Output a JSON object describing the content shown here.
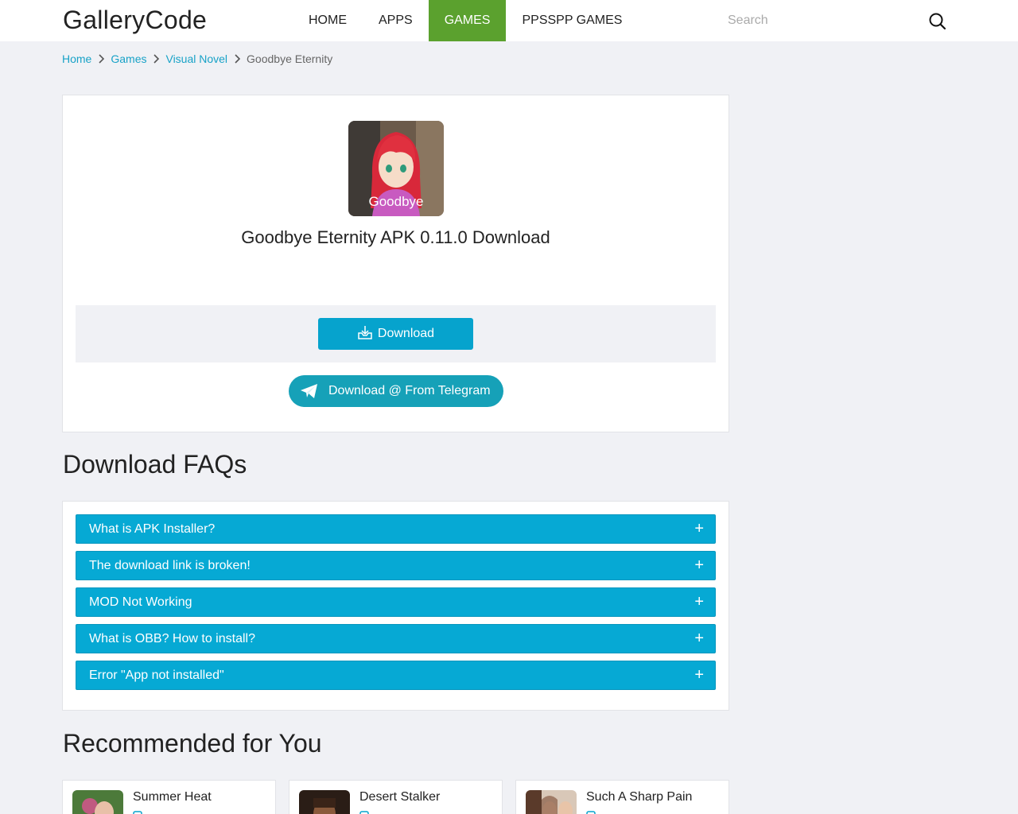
{
  "header": {
    "logo": "GalleryCode",
    "nav": [
      {
        "label": "HOME",
        "active": false
      },
      {
        "label": "APPS",
        "active": false
      },
      {
        "label": "GAMES",
        "active": true
      },
      {
        "label": "PPSSPP GAMES",
        "active": false
      }
    ],
    "search_placeholder": "Search"
  },
  "breadcrumb": {
    "items": [
      "Home",
      "Games",
      "Visual Novel"
    ],
    "current": "Goodbye Eternity"
  },
  "app": {
    "icon_text": "Goodbye",
    "title": "Goodbye Eternity APK 0.11.0 Download",
    "download_label": "Download",
    "telegram_label": "Download @ From Telegram"
  },
  "faq": {
    "title": "Download FAQs",
    "items": [
      "What is APK Installer?",
      "The download link is broken!",
      "MOD Not Working",
      "What is OBB? How to install?",
      "Error \"App not installed\""
    ]
  },
  "recommended": {
    "title": "Recommended for You",
    "items": [
      {
        "name": "Summer Heat"
      },
      {
        "name": "Desert Stalker"
      },
      {
        "name": "Such A Sharp Pain"
      }
    ]
  },
  "colors": {
    "accent": "#06a3cd",
    "nav_active": "#5ba12e",
    "link": "#18a2c7",
    "telegram": "#16a1b8"
  }
}
